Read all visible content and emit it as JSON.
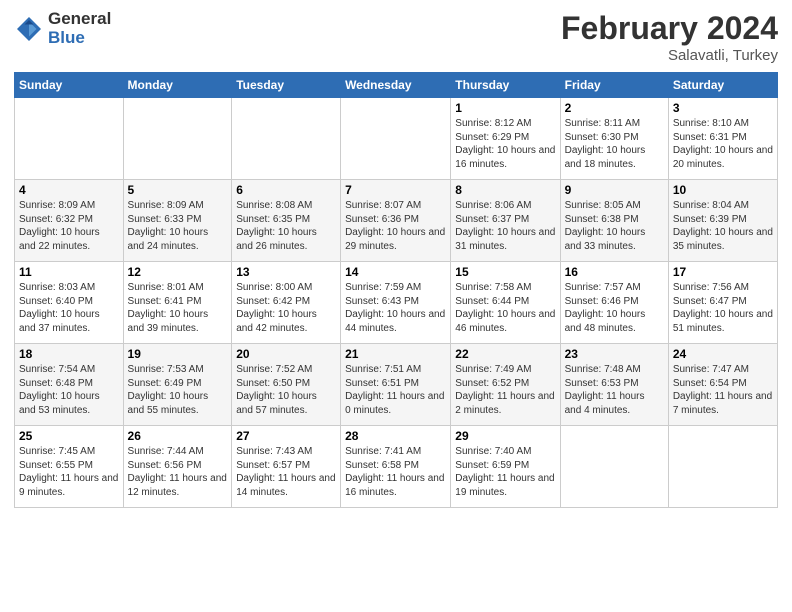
{
  "header": {
    "logo_general": "General",
    "logo_blue": "Blue",
    "title": "February 2024",
    "subtitle": "Salavatli, Turkey"
  },
  "weekdays": [
    "Sunday",
    "Monday",
    "Tuesday",
    "Wednesday",
    "Thursday",
    "Friday",
    "Saturday"
  ],
  "weeks": [
    [
      {
        "day": "",
        "info": ""
      },
      {
        "day": "",
        "info": ""
      },
      {
        "day": "",
        "info": ""
      },
      {
        "day": "",
        "info": ""
      },
      {
        "day": "1",
        "info": "Sunrise: 8:12 AM\nSunset: 6:29 PM\nDaylight: 10 hours and 16 minutes."
      },
      {
        "day": "2",
        "info": "Sunrise: 8:11 AM\nSunset: 6:30 PM\nDaylight: 10 hours and 18 minutes."
      },
      {
        "day": "3",
        "info": "Sunrise: 8:10 AM\nSunset: 6:31 PM\nDaylight: 10 hours and 20 minutes."
      }
    ],
    [
      {
        "day": "4",
        "info": "Sunrise: 8:09 AM\nSunset: 6:32 PM\nDaylight: 10 hours and 22 minutes."
      },
      {
        "day": "5",
        "info": "Sunrise: 8:09 AM\nSunset: 6:33 PM\nDaylight: 10 hours and 24 minutes."
      },
      {
        "day": "6",
        "info": "Sunrise: 8:08 AM\nSunset: 6:35 PM\nDaylight: 10 hours and 26 minutes."
      },
      {
        "day": "7",
        "info": "Sunrise: 8:07 AM\nSunset: 6:36 PM\nDaylight: 10 hours and 29 minutes."
      },
      {
        "day": "8",
        "info": "Sunrise: 8:06 AM\nSunset: 6:37 PM\nDaylight: 10 hours and 31 minutes."
      },
      {
        "day": "9",
        "info": "Sunrise: 8:05 AM\nSunset: 6:38 PM\nDaylight: 10 hours and 33 minutes."
      },
      {
        "day": "10",
        "info": "Sunrise: 8:04 AM\nSunset: 6:39 PM\nDaylight: 10 hours and 35 minutes."
      }
    ],
    [
      {
        "day": "11",
        "info": "Sunrise: 8:03 AM\nSunset: 6:40 PM\nDaylight: 10 hours and 37 minutes."
      },
      {
        "day": "12",
        "info": "Sunrise: 8:01 AM\nSunset: 6:41 PM\nDaylight: 10 hours and 39 minutes."
      },
      {
        "day": "13",
        "info": "Sunrise: 8:00 AM\nSunset: 6:42 PM\nDaylight: 10 hours and 42 minutes."
      },
      {
        "day": "14",
        "info": "Sunrise: 7:59 AM\nSunset: 6:43 PM\nDaylight: 10 hours and 44 minutes."
      },
      {
        "day": "15",
        "info": "Sunrise: 7:58 AM\nSunset: 6:44 PM\nDaylight: 10 hours and 46 minutes."
      },
      {
        "day": "16",
        "info": "Sunrise: 7:57 AM\nSunset: 6:46 PM\nDaylight: 10 hours and 48 minutes."
      },
      {
        "day": "17",
        "info": "Sunrise: 7:56 AM\nSunset: 6:47 PM\nDaylight: 10 hours and 51 minutes."
      }
    ],
    [
      {
        "day": "18",
        "info": "Sunrise: 7:54 AM\nSunset: 6:48 PM\nDaylight: 10 hours and 53 minutes."
      },
      {
        "day": "19",
        "info": "Sunrise: 7:53 AM\nSunset: 6:49 PM\nDaylight: 10 hours and 55 minutes."
      },
      {
        "day": "20",
        "info": "Sunrise: 7:52 AM\nSunset: 6:50 PM\nDaylight: 10 hours and 57 minutes."
      },
      {
        "day": "21",
        "info": "Sunrise: 7:51 AM\nSunset: 6:51 PM\nDaylight: 11 hours and 0 minutes."
      },
      {
        "day": "22",
        "info": "Sunrise: 7:49 AM\nSunset: 6:52 PM\nDaylight: 11 hours and 2 minutes."
      },
      {
        "day": "23",
        "info": "Sunrise: 7:48 AM\nSunset: 6:53 PM\nDaylight: 11 hours and 4 minutes."
      },
      {
        "day": "24",
        "info": "Sunrise: 7:47 AM\nSunset: 6:54 PM\nDaylight: 11 hours and 7 minutes."
      }
    ],
    [
      {
        "day": "25",
        "info": "Sunrise: 7:45 AM\nSunset: 6:55 PM\nDaylight: 11 hours and 9 minutes."
      },
      {
        "day": "26",
        "info": "Sunrise: 7:44 AM\nSunset: 6:56 PM\nDaylight: 11 hours and 12 minutes."
      },
      {
        "day": "27",
        "info": "Sunrise: 7:43 AM\nSunset: 6:57 PM\nDaylight: 11 hours and 14 minutes."
      },
      {
        "day": "28",
        "info": "Sunrise: 7:41 AM\nSunset: 6:58 PM\nDaylight: 11 hours and 16 minutes."
      },
      {
        "day": "29",
        "info": "Sunrise: 7:40 AM\nSunset: 6:59 PM\nDaylight: 11 hours and 19 minutes."
      },
      {
        "day": "",
        "info": ""
      },
      {
        "day": "",
        "info": ""
      }
    ]
  ]
}
